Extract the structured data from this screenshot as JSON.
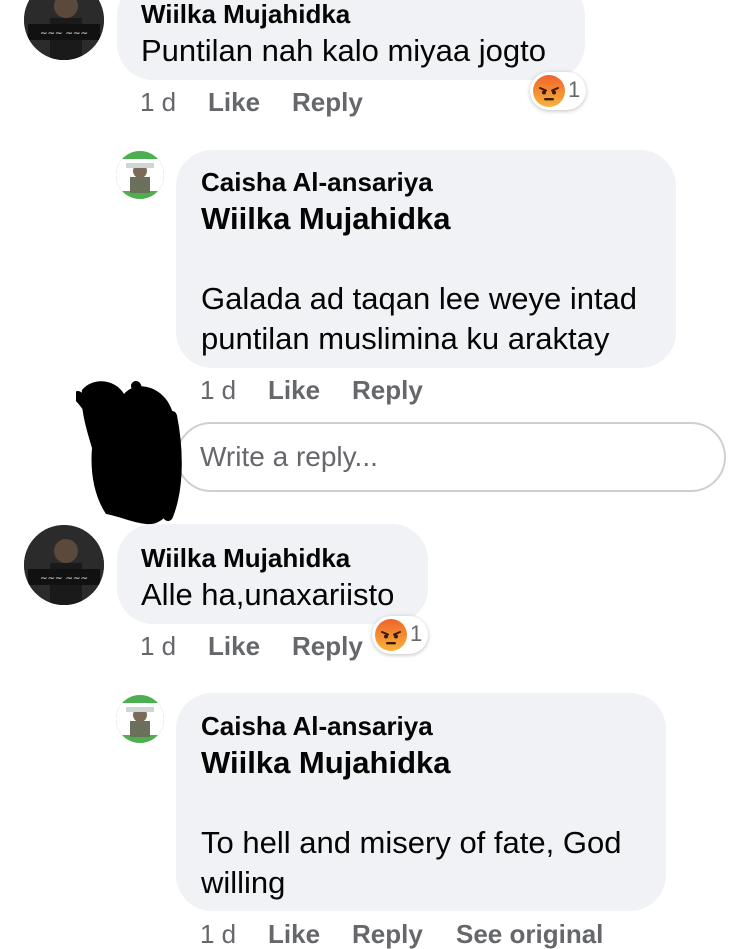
{
  "comments": [
    {
      "author": "Wiilka Mujahidka",
      "text": "Puntilan nah kalo miyaa jogto",
      "time": "1 d",
      "like": "Like",
      "reply": "Reply",
      "reaction": {
        "icon": "angry-reaction-icon",
        "count": "1"
      }
    },
    {
      "author": "Caisha Al-ansariya",
      "mention": "Wiilka Mujahidka",
      "text": "Galada ad taqan lee weye intad puntilan muslimina ku araktay",
      "time": "1 d",
      "like": "Like",
      "reply": "Reply"
    },
    {
      "author": "Wiilka Mujahidka",
      "text": "Alle ha,unaxariisto",
      "time": "1 d",
      "like": "Like",
      "reply": "Reply",
      "reaction": {
        "icon": "angry-reaction-icon",
        "count": "1"
      }
    },
    {
      "author": "Caisha Al-ansariya",
      "mention": "Wiilka Mujahidka",
      "text": "To hell and misery of fate, God willing",
      "time": "1 d",
      "like": "Like",
      "reply": "Reply",
      "see_original": "See original"
    }
  ],
  "reply_box": {
    "placeholder": "Write a reply..."
  },
  "colors": {
    "bubble": "#f0f2f5",
    "secondary_text": "#65676b",
    "angry_top": "#f0642a",
    "angry_bottom": "#f8b33a"
  }
}
